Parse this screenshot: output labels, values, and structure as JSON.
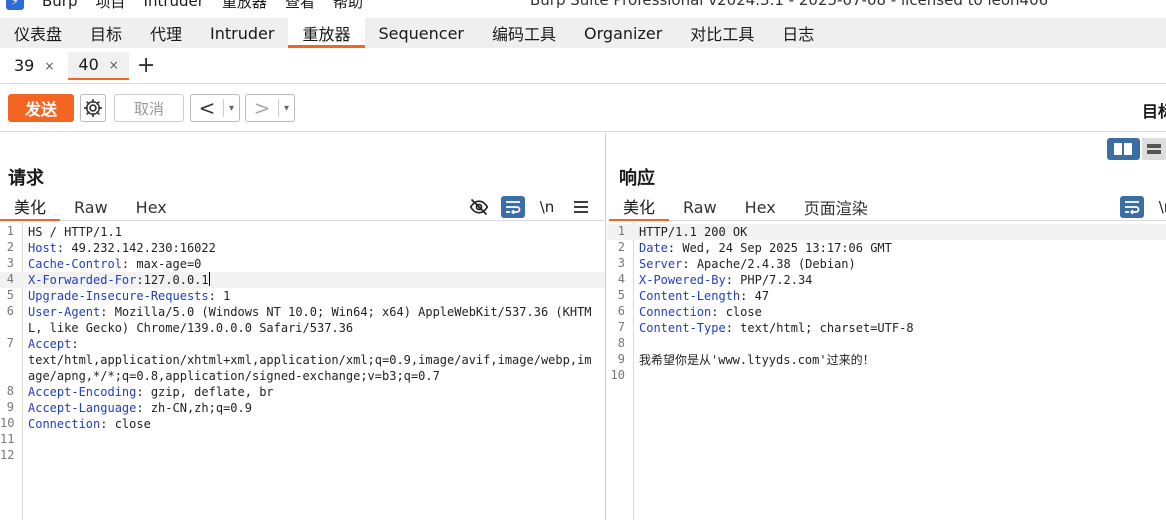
{
  "app": {
    "name": "Burp",
    "window_title": "Burp Suite Professional v2024.3.1 - 2025-07-08 - licensed to leon406",
    "menu": [
      "Burp",
      "项目",
      "Intruder",
      "重放器",
      "查看",
      "帮助"
    ]
  },
  "main_tabs": [
    "仪表盘",
    "目标",
    "代理",
    "Intruder",
    "重放器",
    "Sequencer",
    "编码工具",
    "Organizer",
    "对比工具",
    "日志"
  ],
  "active_main_tab": "重放器",
  "sub_tabs": [
    {
      "label": "39",
      "close": "×"
    },
    {
      "label": "40",
      "close": "×"
    }
  ],
  "add_tab": "+",
  "toolbar": {
    "send_label": "发送",
    "cancel_label": "取消",
    "back": "<",
    "forward": ">",
    "dropdown": "▾",
    "target_label": "目标"
  },
  "request": {
    "title": "请求",
    "tabs": [
      "美化",
      "Raw",
      "Hex"
    ],
    "active_tab": "美化",
    "lines": [
      {
        "n": "1",
        "key": "",
        "sep": "",
        "val": "HS / HTTP/1.1"
      },
      {
        "n": "2",
        "key": "Host",
        "sep": ": ",
        "val": "49.232.142.230:16022"
      },
      {
        "n": "3",
        "key": "Cache-Control",
        "sep": ": ",
        "val": "max-age=0"
      },
      {
        "n": "4",
        "key": "X-Forwarded-For",
        "sep": ":",
        "val": "127.0.0.1"
      },
      {
        "n": "5",
        "key": "Upgrade-Insecure-Requests",
        "sep": ": ",
        "val": "1"
      },
      {
        "n": "6",
        "key": "User-Agent",
        "sep": ": ",
        "val": "Mozilla/5.0 (Windows NT 10.0; Win64; x64) AppleWebKit/537.36 (KHTML, like Gecko) Chrome/139.0.0.0 Safari/537.36"
      },
      {
        "n": "7",
        "key": "Accept",
        "sep": ":",
        "val": "text/html,application/xhtml+xml,application/xml;q=0.9,image/avif,image/webp,image/apng,*/*;q=0.8,application/signed-exchange;v=b3;q=0.7"
      },
      {
        "n": "8",
        "key": "Accept-Encoding",
        "sep": ": ",
        "val": "gzip, deflate, br"
      },
      {
        "n": "9",
        "key": "Accept-Language",
        "sep": ": ",
        "val": "zh-CN,zh;q=0.9"
      },
      {
        "n": "10",
        "key": "Connection",
        "sep": ": ",
        "val": "close"
      },
      {
        "n": "11",
        "key": "",
        "sep": "",
        "val": ""
      },
      {
        "n": "12",
        "key": "",
        "sep": "",
        "val": ""
      }
    ]
  },
  "response": {
    "title": "响应",
    "tabs": [
      "美化",
      "Raw",
      "Hex",
      "页面渲染"
    ],
    "active_tab": "美化",
    "lines": [
      {
        "n": "1",
        "key": "",
        "sep": "",
        "val": "HTTP/1.1 200 OK"
      },
      {
        "n": "2",
        "key": "Date",
        "sep": ": ",
        "val": "Wed, 24 Sep 2025 13:17:06 GMT"
      },
      {
        "n": "3",
        "key": "Server",
        "sep": ": ",
        "val": "Apache/2.4.38 (Debian)"
      },
      {
        "n": "4",
        "key": "X-Powered-By",
        "sep": ": ",
        "val": "PHP/7.2.34"
      },
      {
        "n": "5",
        "key": "Content-Length",
        "sep": ": ",
        "val": "47"
      },
      {
        "n": "6",
        "key": "Connection",
        "sep": ": ",
        "val": "close"
      },
      {
        "n": "7",
        "key": "Content-Type",
        "sep": ": ",
        "val": "text/html; charset=UTF-8"
      },
      {
        "n": "8",
        "key": "",
        "sep": "",
        "val": ""
      },
      {
        "n": "9",
        "key": "",
        "sep": "",
        "val": "我希望你是从'www.ltyyds.com'过来的！"
      },
      {
        "n": "10",
        "key": "",
        "sep": "",
        "val": ""
      }
    ]
  },
  "icons": {
    "request_toolbar": [
      "eye-slash-icon",
      "wrap-icon",
      "newline-icon",
      "menu-icon"
    ],
    "newline_text": "\\n",
    "colors": {
      "accent": "#f26522",
      "header_key": "#1f3fbf",
      "toggle_blue": "#3a6ea5"
    }
  }
}
